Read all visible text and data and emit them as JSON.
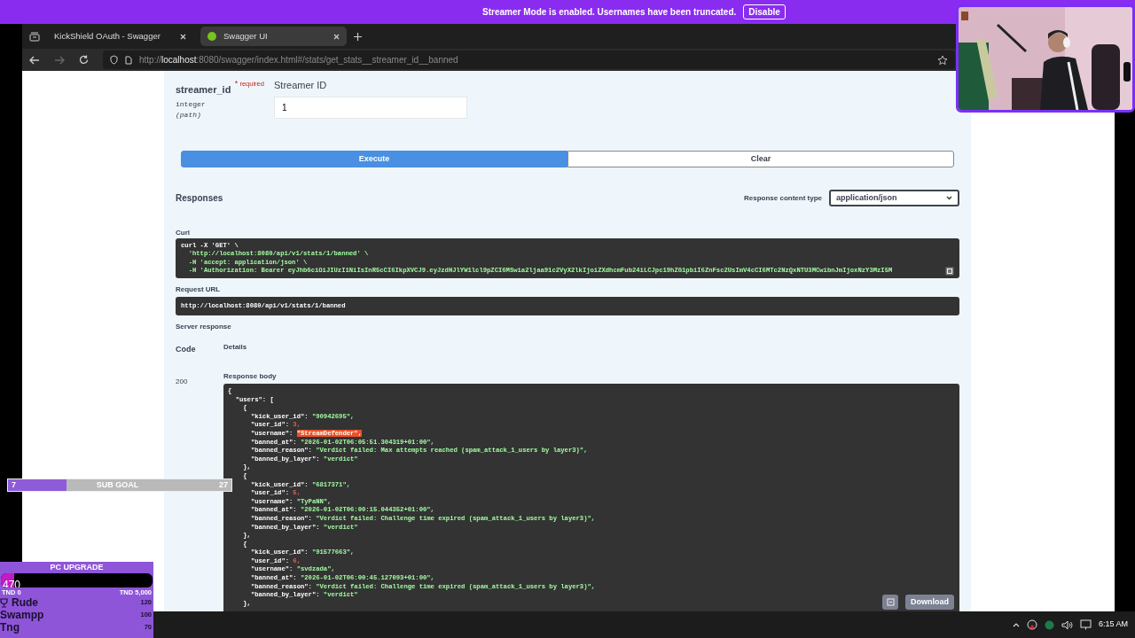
{
  "banner": {
    "text": "Streamer Mode is enabled. Usernames have been truncated.",
    "button": "Disable"
  },
  "browser": {
    "tabs": [
      {
        "title": "KickShield OAuth - Swagger",
        "selected": false
      },
      {
        "title": "Swagger UI",
        "selected": true
      }
    ],
    "url": "http://**localhost**:8080/swagger/index.html#/stats/get_stats__streamer_id__banned"
  },
  "parameter": {
    "name": "streamer_id",
    "required_mark": "*",
    "required_label": "required",
    "type": "integer",
    "location": "(path)",
    "description": "Streamer ID",
    "value": "1"
  },
  "actions": {
    "execute": "Execute",
    "clear": "Clear"
  },
  "responses": {
    "title": "Responses",
    "content_type_label": "Response content type",
    "content_type": "application/json",
    "curl_label": "Curl",
    "curl_lines": [
      "curl -X 'GET' \\",
      "  'http://localhost:8080/api/v1/stats/1/banned' \\",
      "  -H 'accept: application/json' \\",
      "  -H 'Authorization: Bearer eyJhbGciOiJIUzI1NiIsInR5cCI6IkpXVCJ9.eyJzdHJlYW1lcl9pZCI6MSwia2ljaa91c2VyX2lkIjoiZXdhcmFub24iLCJpc19hZG1pbiI6ZnFsc2UsImV4cCI6MTc2NzQxNTU3MCwibnJmIjoxNzY3MzI5M"
    ],
    "request_url_label": "Request URL",
    "request_url": "http://localhost:8080/api/v1/stats/1/banned",
    "server_response_label": "Server response",
    "code_header": "Code",
    "details_header": "Details",
    "code": "200",
    "body_label": "Response body",
    "body_lines": [
      {
        "key": "{",
        "selected": false
      },
      {
        "key": "  \"users\": ",
        "value": "[",
        "kind": "punct",
        "selected": false
      },
      {
        "key": "    {",
        "selected": false
      },
      {
        "key": "      \"kick_user_id\": ",
        "value": "\"90942695\",",
        "kind": "string",
        "selected": false
      },
      {
        "key": "      \"user_id\": ",
        "value": "3,",
        "kind": "number",
        "selected": false
      },
      {
        "key": "      \"username\": ",
        "value": "\"StreamDefender\",",
        "kind": "string",
        "selected": true
      },
      {
        "key": "      \"banned_at\": ",
        "value": "\"2026-01-02T06:05:51.304319+01:00\",",
        "kind": "string",
        "selected": false
      },
      {
        "key": "      \"banned_reason\": ",
        "value": "\"Verdict failed: Max attempts reached (spam_attack_1_users by layer3)\",",
        "kind": "string",
        "selected": false
      },
      {
        "key": "      \"banned_by_layer\": ",
        "value": "\"verdict\"",
        "kind": "string",
        "selected": false
      },
      {
        "key": "    },",
        "selected": false
      },
      {
        "key": "    {",
        "selected": false
      },
      {
        "key": "      \"kick_user_id\": ",
        "value": "\"6817371\",",
        "kind": "string",
        "selected": false
      },
      {
        "key": "      \"user_id\": ",
        "value": "5,",
        "kind": "number",
        "selected": false
      },
      {
        "key": "      \"username\": ",
        "value": "\"TyPaNN\",",
        "kind": "string",
        "selected": false
      },
      {
        "key": "      \"banned_at\": ",
        "value": "\"2026-01-02T06:00:15.044352+01:00\",",
        "kind": "string",
        "selected": false
      },
      {
        "key": "      \"banned_reason\": ",
        "value": "\"Verdict failed: Challenge time expired (spam_attack_1_users by layer3)\",",
        "kind": "string",
        "selected": false
      },
      {
        "key": "      \"banned_by_layer\": ",
        "value": "\"verdict\"",
        "kind": "string",
        "selected": false
      },
      {
        "key": "    },",
        "selected": false
      },
      {
        "key": "    {",
        "selected": false
      },
      {
        "key": "      \"kick_user_id\": ",
        "value": "\"91577663\",",
        "kind": "string",
        "selected": false
      },
      {
        "key": "      \"user_id\": ",
        "value": "6,",
        "kind": "number",
        "selected": false
      },
      {
        "key": "      \"username\": ",
        "value": "\"svdzada\",",
        "kind": "string",
        "selected": false
      },
      {
        "key": "      \"banned_at\": ",
        "value": "\"2026-01-02T06:00:45.127093+01:00\",",
        "kind": "string",
        "selected": false
      },
      {
        "key": "      \"banned_reason\": ",
        "value": "\"Verdict failed: Challenge time expired (spam_attack_1_users by layer3)\",",
        "kind": "string",
        "selected": false
      },
      {
        "key": "      \"banned_by_layer\": ",
        "value": "\"verdict\"",
        "kind": "string",
        "selected": false
      },
      {
        "key": "    },",
        "selected": false
      }
    ],
    "download": "Download"
  },
  "sub_goal": {
    "current": "7",
    "label": "SUB GOAL",
    "target": "27",
    "level": 0.26
  },
  "pc_upgrade": {
    "title": "PC UPGRADE",
    "amount": "470",
    "level": 0.09,
    "min": "TND 0",
    "max": "TND 5,000",
    "leaders": [
      {
        "name": "Rude",
        "amount": "120",
        "top": true
      },
      {
        "name": "Swampp",
        "amount": "100",
        "top": false
      },
      {
        "name": "Tng",
        "amount": "70",
        "top": false
      }
    ]
  },
  "taskbar": {
    "time": "6:15 AM"
  }
}
